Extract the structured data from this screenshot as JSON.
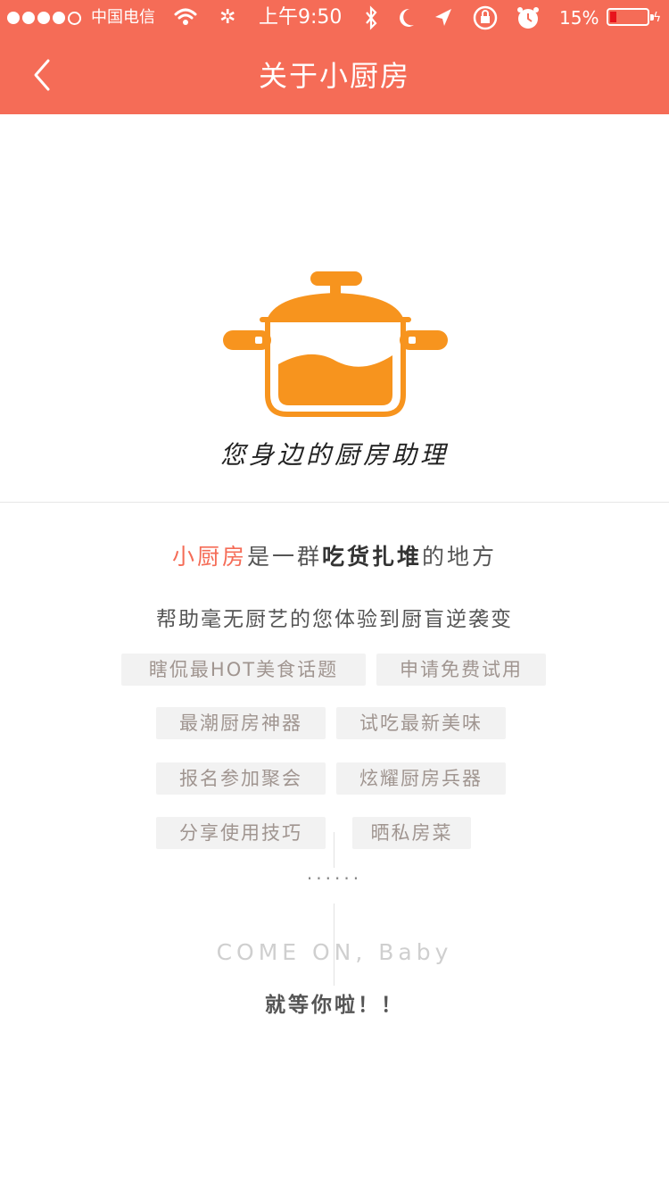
{
  "status_bar": {
    "carrier": "中国电信",
    "time": "上午9:50",
    "battery": "15%",
    "icons": [
      "signal-dots",
      "wifi-icon",
      "activity-icon",
      "bluetooth-icon",
      "moon-icon",
      "location-icon",
      "rotation-lock-icon",
      "alarm-icon",
      "battery-icon",
      "charging-icon"
    ]
  },
  "nav": {
    "back_icon": "chevron-left-icon",
    "title": "关于小厨房"
  },
  "hero": {
    "logo_icon": "cooking-pot-icon",
    "slogan": "您身边的厨房助理"
  },
  "intro": {
    "line1": {
      "brand": "小厨房",
      "part1": "是一群",
      "highlight": "吃货扎堆",
      "part2": "的地方"
    },
    "line2": "帮助毫无厨艺的您体验到厨盲逆袭变"
  },
  "tags": [
    "瞎侃最HOT美食话题",
    "申请免费试用",
    "最潮厨房神器",
    "试吃最新美味",
    "报名参加聚会",
    "炫耀厨房兵器",
    "分享使用技巧",
    "晒私房菜"
  ],
  "ellipsis": "......",
  "footer": {
    "come_on": "COME ON, Baby",
    "waiting": "就等你啦！！"
  },
  "colors": {
    "accent": "#f56c57",
    "pot": "#f7941e",
    "tag_bg": "#f2f2f2",
    "tag_text": "#a09590"
  }
}
